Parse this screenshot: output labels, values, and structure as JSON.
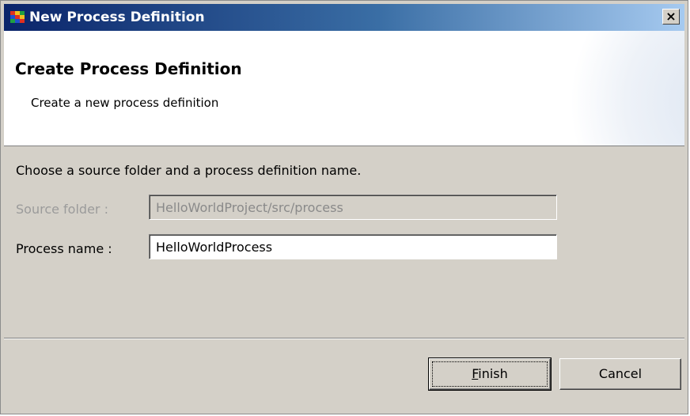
{
  "window": {
    "title": "New Process Definition",
    "close_glyph": "×"
  },
  "header": {
    "title": "Create Process Definition",
    "description": "Create a new process definition"
  },
  "form": {
    "instruction": "Choose a source folder and a process definition name.",
    "source_folder": {
      "label": "Source folder :",
      "value": "HelloWorldProject/src/process",
      "enabled": false
    },
    "process_name": {
      "label": "Process name :",
      "value": "HelloWorldProcess",
      "enabled": true
    }
  },
  "buttons": {
    "finish": {
      "accel": "F",
      "rest": "inish"
    },
    "cancel": {
      "label": "Cancel"
    }
  },
  "icons": {
    "app_icon": "jbpm-grid-icon",
    "close_icon": "close-icon"
  },
  "colors": {
    "titlebar_start": "#0a246a",
    "titlebar_end": "#a6caf0",
    "dialog_face": "#d4d0c8",
    "disabled_text": "#9b9b9b"
  }
}
